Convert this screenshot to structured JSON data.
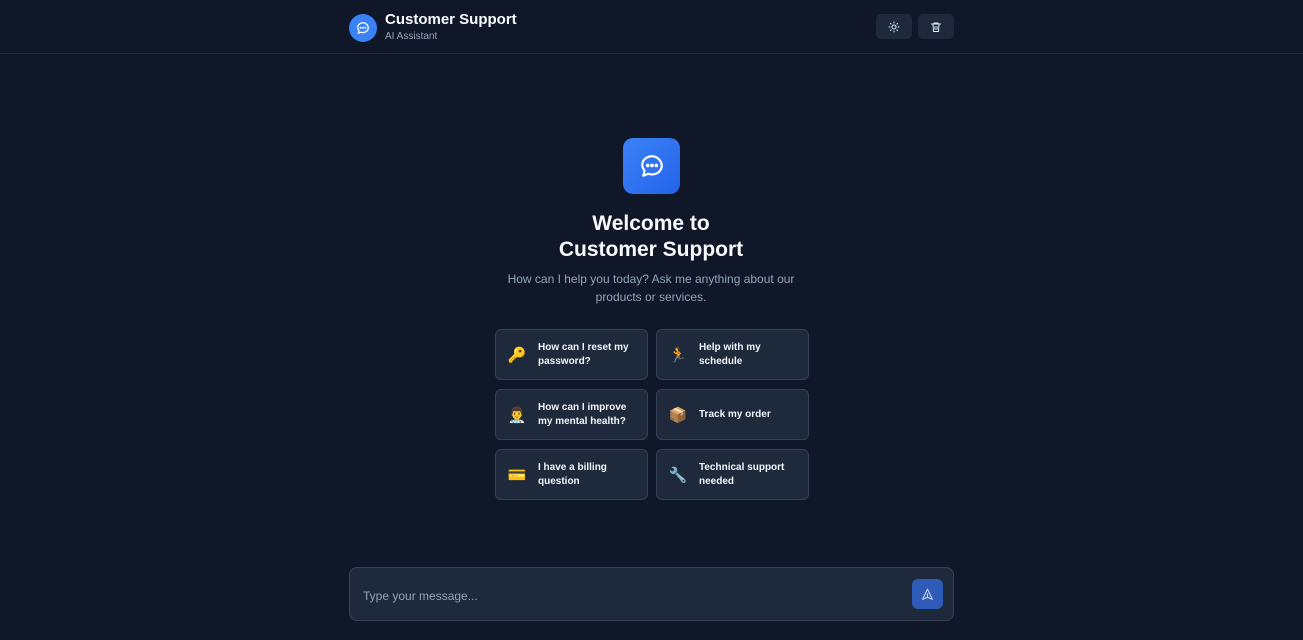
{
  "header": {
    "title": "Customer Support",
    "subtitle": "AI Assistant",
    "theme_button_icon": "sun-icon",
    "clear_button_icon": "trash-icon"
  },
  "welcome": {
    "icon": "chat-bubble-icon",
    "title_line1": "Welcome to",
    "title_line2": "Customer Support",
    "subtitle": "How can I help you today? Ask me anything about our products or services."
  },
  "suggestions": [
    {
      "emoji": "🔑",
      "label": "How can I reset my password?"
    },
    {
      "emoji": "🏃",
      "label": "Help with my schedule"
    },
    {
      "emoji": "👨‍⚕️",
      "label": "How can I improve my mental health?"
    },
    {
      "emoji": "📦",
      "label": "Track my order"
    },
    {
      "emoji": "💳",
      "label": "I have a billing question"
    },
    {
      "emoji": "🔧",
      "label": "Technical support needed"
    }
  ],
  "composer": {
    "placeholder": "Type your message...",
    "send_icon": "send-icon"
  },
  "colors": {
    "background": "#0f1729",
    "accent": "#3b82f6",
    "card": "#1e293b"
  }
}
